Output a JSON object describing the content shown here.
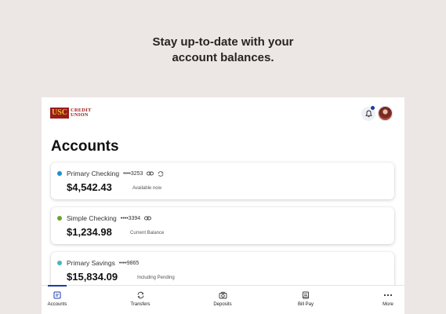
{
  "headline": {
    "line1": "Stay up-to-date with your",
    "line2": "account balances."
  },
  "logo": {
    "mark": "USC",
    "line1": "CREDIT",
    "line2": "UNION"
  },
  "header": {
    "bell_icon": "bell-icon",
    "avatar": "profile-avatar"
  },
  "page": {
    "title": "Accounts"
  },
  "accounts": [
    {
      "name": "Primary Checking",
      "mask": "••••3253",
      "balance": "$4,542.43",
      "balance_note": "Available now",
      "dot_color": "#1e8fcf",
      "icons": [
        "link-icon",
        "sync-icon"
      ]
    },
    {
      "name": "Simple Checking",
      "mask": "••••3394",
      "balance": "$1,234.98",
      "balance_note": "Current Balance",
      "dot_color": "#6aa52c",
      "icons": [
        "link-icon"
      ]
    },
    {
      "name": "Primary Savings",
      "mask": "••••9865",
      "balance": "$15,834.09",
      "balance_note": "Including Pending",
      "dot_color": "#4bb4bf",
      "icons": []
    }
  ],
  "tabs": [
    {
      "label": "Accounts",
      "icon": "accounts-icon",
      "active": true
    },
    {
      "label": "Transfers",
      "icon": "transfer-icon",
      "active": false
    },
    {
      "label": "Deposits",
      "icon": "camera-icon",
      "active": false
    },
    {
      "label": "Bill Pay",
      "icon": "bill-icon",
      "active": false
    },
    {
      "label": "More",
      "icon": "more-icon",
      "active": false
    }
  ],
  "colors": {
    "background": "#ece6e4",
    "brand": "#9a1b1b",
    "accent": "#1d3aa8"
  }
}
